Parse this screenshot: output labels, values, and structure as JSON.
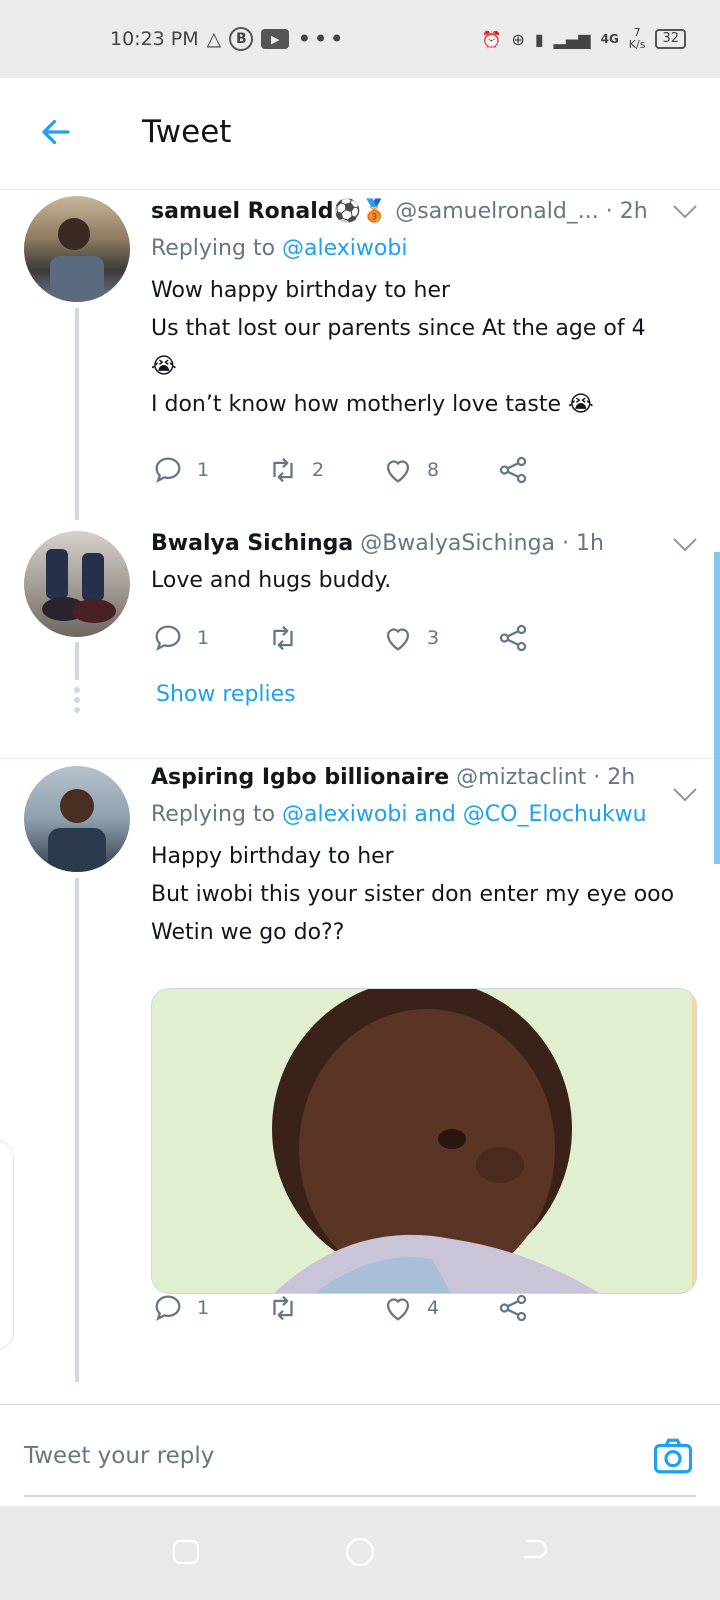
{
  "status_bar": {
    "time": "10:23 PM",
    "network": "4G",
    "speed_value": "7",
    "speed_unit": "K/s",
    "battery": "32"
  },
  "header": {
    "title": "Tweet"
  },
  "tweets": [
    {
      "name": "samuel Ronald⚽🥉",
      "handle": "@samuelronald_...",
      "time": "· 2h",
      "replying_label": "Replying to",
      "replying_to": "@alexiwobi",
      "lines": [
        "Wow happy birthday  to her",
        "Us that lost our parents since At  the age of 4",
        "😭",
        "I don’t know how motherly love taste 😭"
      ],
      "replies": "1",
      "retweets": "2",
      "likes": "8"
    },
    {
      "name": "Bwalya Sichinga",
      "handle": "@BwalyaSichinga",
      "time": "· 1h",
      "lines": [
        "Love and hugs buddy."
      ],
      "replies": "1",
      "retweets": "",
      "likes": "3",
      "show_replies": "Show replies"
    },
    {
      "name": "Aspiring Igbo billionaire",
      "handle": "@miztaclint",
      "time": "· 2h",
      "replying_label": "Replying to",
      "replying_to": "@alexiwobi and @CO_Elochukwu",
      "lines": [
        "Happy birthday to her",
        "But iwobi this your sister don enter my eye ooo",
        "Wetin we go do??"
      ],
      "replies": "1",
      "retweets": "",
      "likes": "4"
    }
  ],
  "reply_bar": {
    "placeholder": "Tweet your reply"
  },
  "colors": {
    "accent": "#1da1f2",
    "secondary_text": "#657786",
    "divider": "#e1e8ed"
  },
  "icons": {
    "back": "arrow-left-icon",
    "reply": "comment-icon",
    "retweet": "retweet-icon",
    "like": "heart-icon",
    "share": "share-icon",
    "caret": "chevron-down-icon",
    "camera": "camera-icon"
  }
}
